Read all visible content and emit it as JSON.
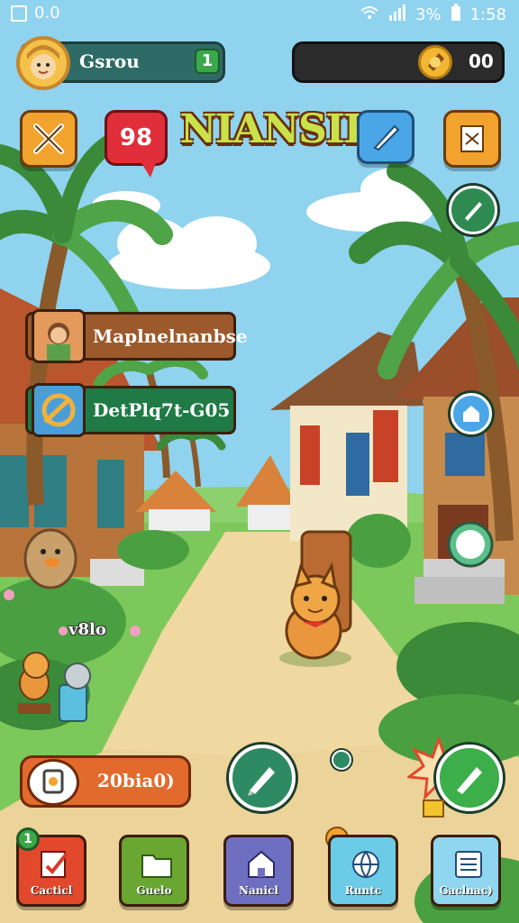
{
  "status_bar": {
    "left_text": "0.0",
    "battery": "3%",
    "time": "1:58"
  },
  "profile": {
    "name": "Gsrou",
    "level": "1"
  },
  "currency": {
    "value": "00"
  },
  "header": {
    "title": "NIANSIE",
    "notification_count": "98"
  },
  "banners": [
    {
      "label": "Maplnelnanbse"
    },
    {
      "label": "DetPlq7t-G05"
    }
  ],
  "scene": {
    "label": "v8lo"
  },
  "timer": {
    "value": "20bia0)"
  },
  "nav": [
    {
      "label": "Cacticl",
      "color": "#e2482c"
    },
    {
      "label": "Guelo",
      "color": "#6aa632"
    },
    {
      "label": "Nanicl",
      "color": "#6f6fc2"
    },
    {
      "label": "Runtc",
      "color": "#6ccbe6"
    },
    {
      "label": "Gaclnac)",
      "color": "#8fd6ee"
    }
  ],
  "nav_badge": "1",
  "colors": {
    "sky": "#8fd3ef",
    "path": "#f0d9a0",
    "grass": "#7cc85a",
    "accent_green": "#2fa86a",
    "accent_orange": "#e36a2d"
  }
}
